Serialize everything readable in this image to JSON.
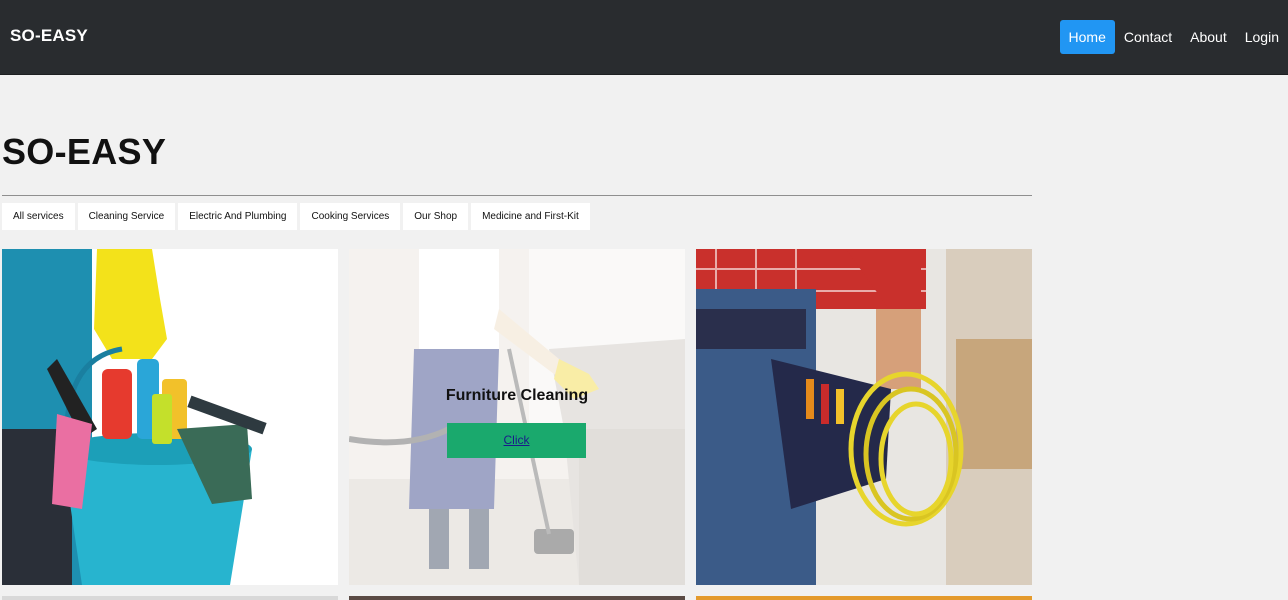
{
  "navbar": {
    "brand": "SO-EASY",
    "links": [
      {
        "label": "Home",
        "active": true
      },
      {
        "label": "Contact",
        "active": false
      },
      {
        "label": "About",
        "active": false
      },
      {
        "label": "Login",
        "active": false
      }
    ]
  },
  "main": {
    "title": "SO-EASY",
    "filters": [
      "All services",
      "Cleaning Service",
      "Electric And Plumbing",
      "Cooking Services",
      "Our Shop",
      "Medicine and First-Kit"
    ],
    "cards": [
      {
        "image": "cleaning-bucket-photo"
      },
      {
        "image": "furniture-cleaning-photo",
        "overlay_title": "Furniture Cleaning",
        "overlay_button": "Click"
      },
      {
        "image": "electrician-photo"
      }
    ]
  },
  "colors": {
    "navbar_bg": "#292c2f",
    "active_link": "#2196f3",
    "page_bg": "#f1f1f1",
    "overlay_button": "#1aa96d"
  }
}
